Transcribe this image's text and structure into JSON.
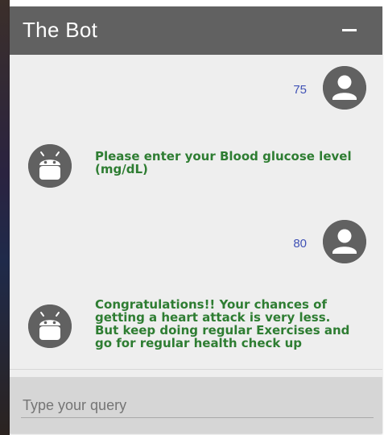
{
  "header": {
    "title": "The Bot",
    "minimize_icon": "minus-icon"
  },
  "messages": [
    {
      "sender": "user",
      "text": "75",
      "avatar_icon": "user-avatar-icon"
    },
    {
      "sender": "bot",
      "text": "Please enter your Blood glucose level (mg/dL)",
      "avatar_icon": "android-robot-icon"
    },
    {
      "sender": "user",
      "text": "80",
      "avatar_icon": "user-avatar-icon"
    },
    {
      "sender": "bot",
      "text": "Congratulations!! Your chances of getting a heart attack is very less. But keep doing regular Exercises and go for regular health check up",
      "avatar_icon": "android-robot-icon"
    }
  ],
  "input": {
    "placeholder": "Type your query",
    "value": ""
  },
  "colors": {
    "header_bg": "#616161",
    "user_text": "#3f51b5",
    "bot_text": "#2e7d32",
    "panel_bg": "#eeeeee",
    "input_bg": "#d6d6d6"
  }
}
